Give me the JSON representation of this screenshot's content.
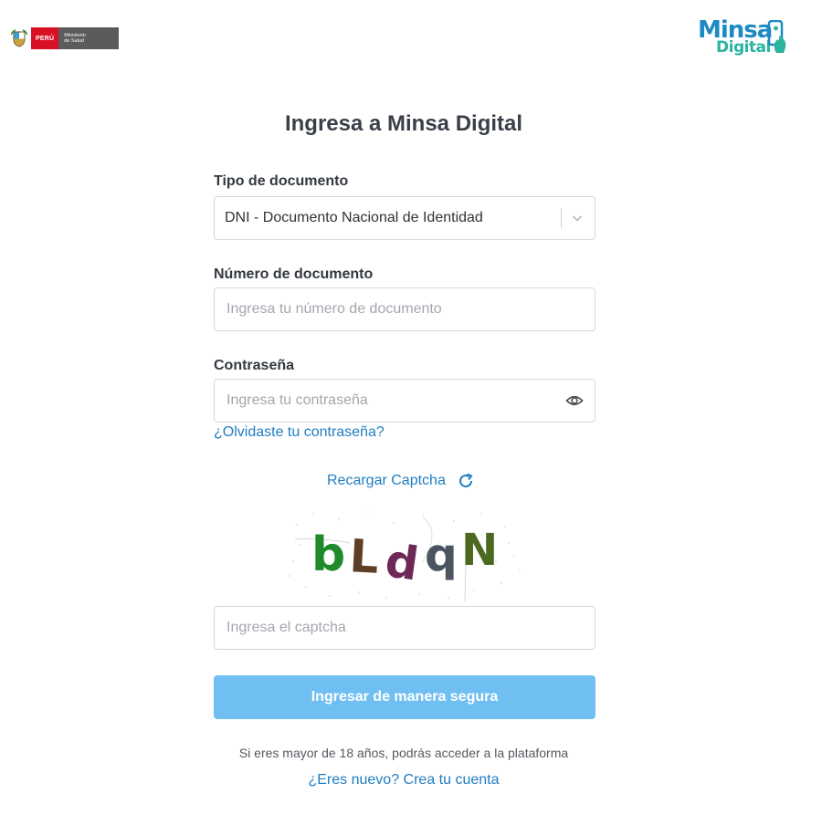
{
  "header": {
    "gov_country": "PERÚ",
    "gov_ministry_line1": "Ministerio",
    "gov_ministry_line2": "de Salud",
    "brand_line1": "Minsa",
    "brand_line2": "Digital"
  },
  "title": "Ingresa a Minsa Digital",
  "document_type": {
    "label": "Tipo de documento",
    "selected": "DNI - Documento Nacional de Identidad"
  },
  "document_number": {
    "label": "Número de documento",
    "placeholder": "Ingresa tu número de documento"
  },
  "password": {
    "label": "Contraseña",
    "placeholder": "Ingresa tu contraseña"
  },
  "forgot_password": "¿Olvidaste tu contraseña?",
  "captcha": {
    "reload_label": "Recargar Captcha",
    "chars": [
      "b",
      "L",
      "d",
      "q",
      "N"
    ],
    "input_placeholder": "Ingresa el captcha"
  },
  "submit_label": "Ingresar de manera segura",
  "age_hint": "Si eres mayor de 18 años, podrás acceder a la plataforma",
  "signup_link": "¿Eres nuevo? Crea tu cuenta",
  "colors": {
    "primary_link": "#1f7dc1",
    "submit_bg": "#70bff2",
    "brand_blue": "#1d8ac4",
    "brand_teal": "#2bb3a0",
    "gov_red": "#d91023"
  },
  "icons": {
    "select_arrow": "chevron-down-icon",
    "password_toggle": "eye-icon",
    "reload": "refresh-icon"
  }
}
